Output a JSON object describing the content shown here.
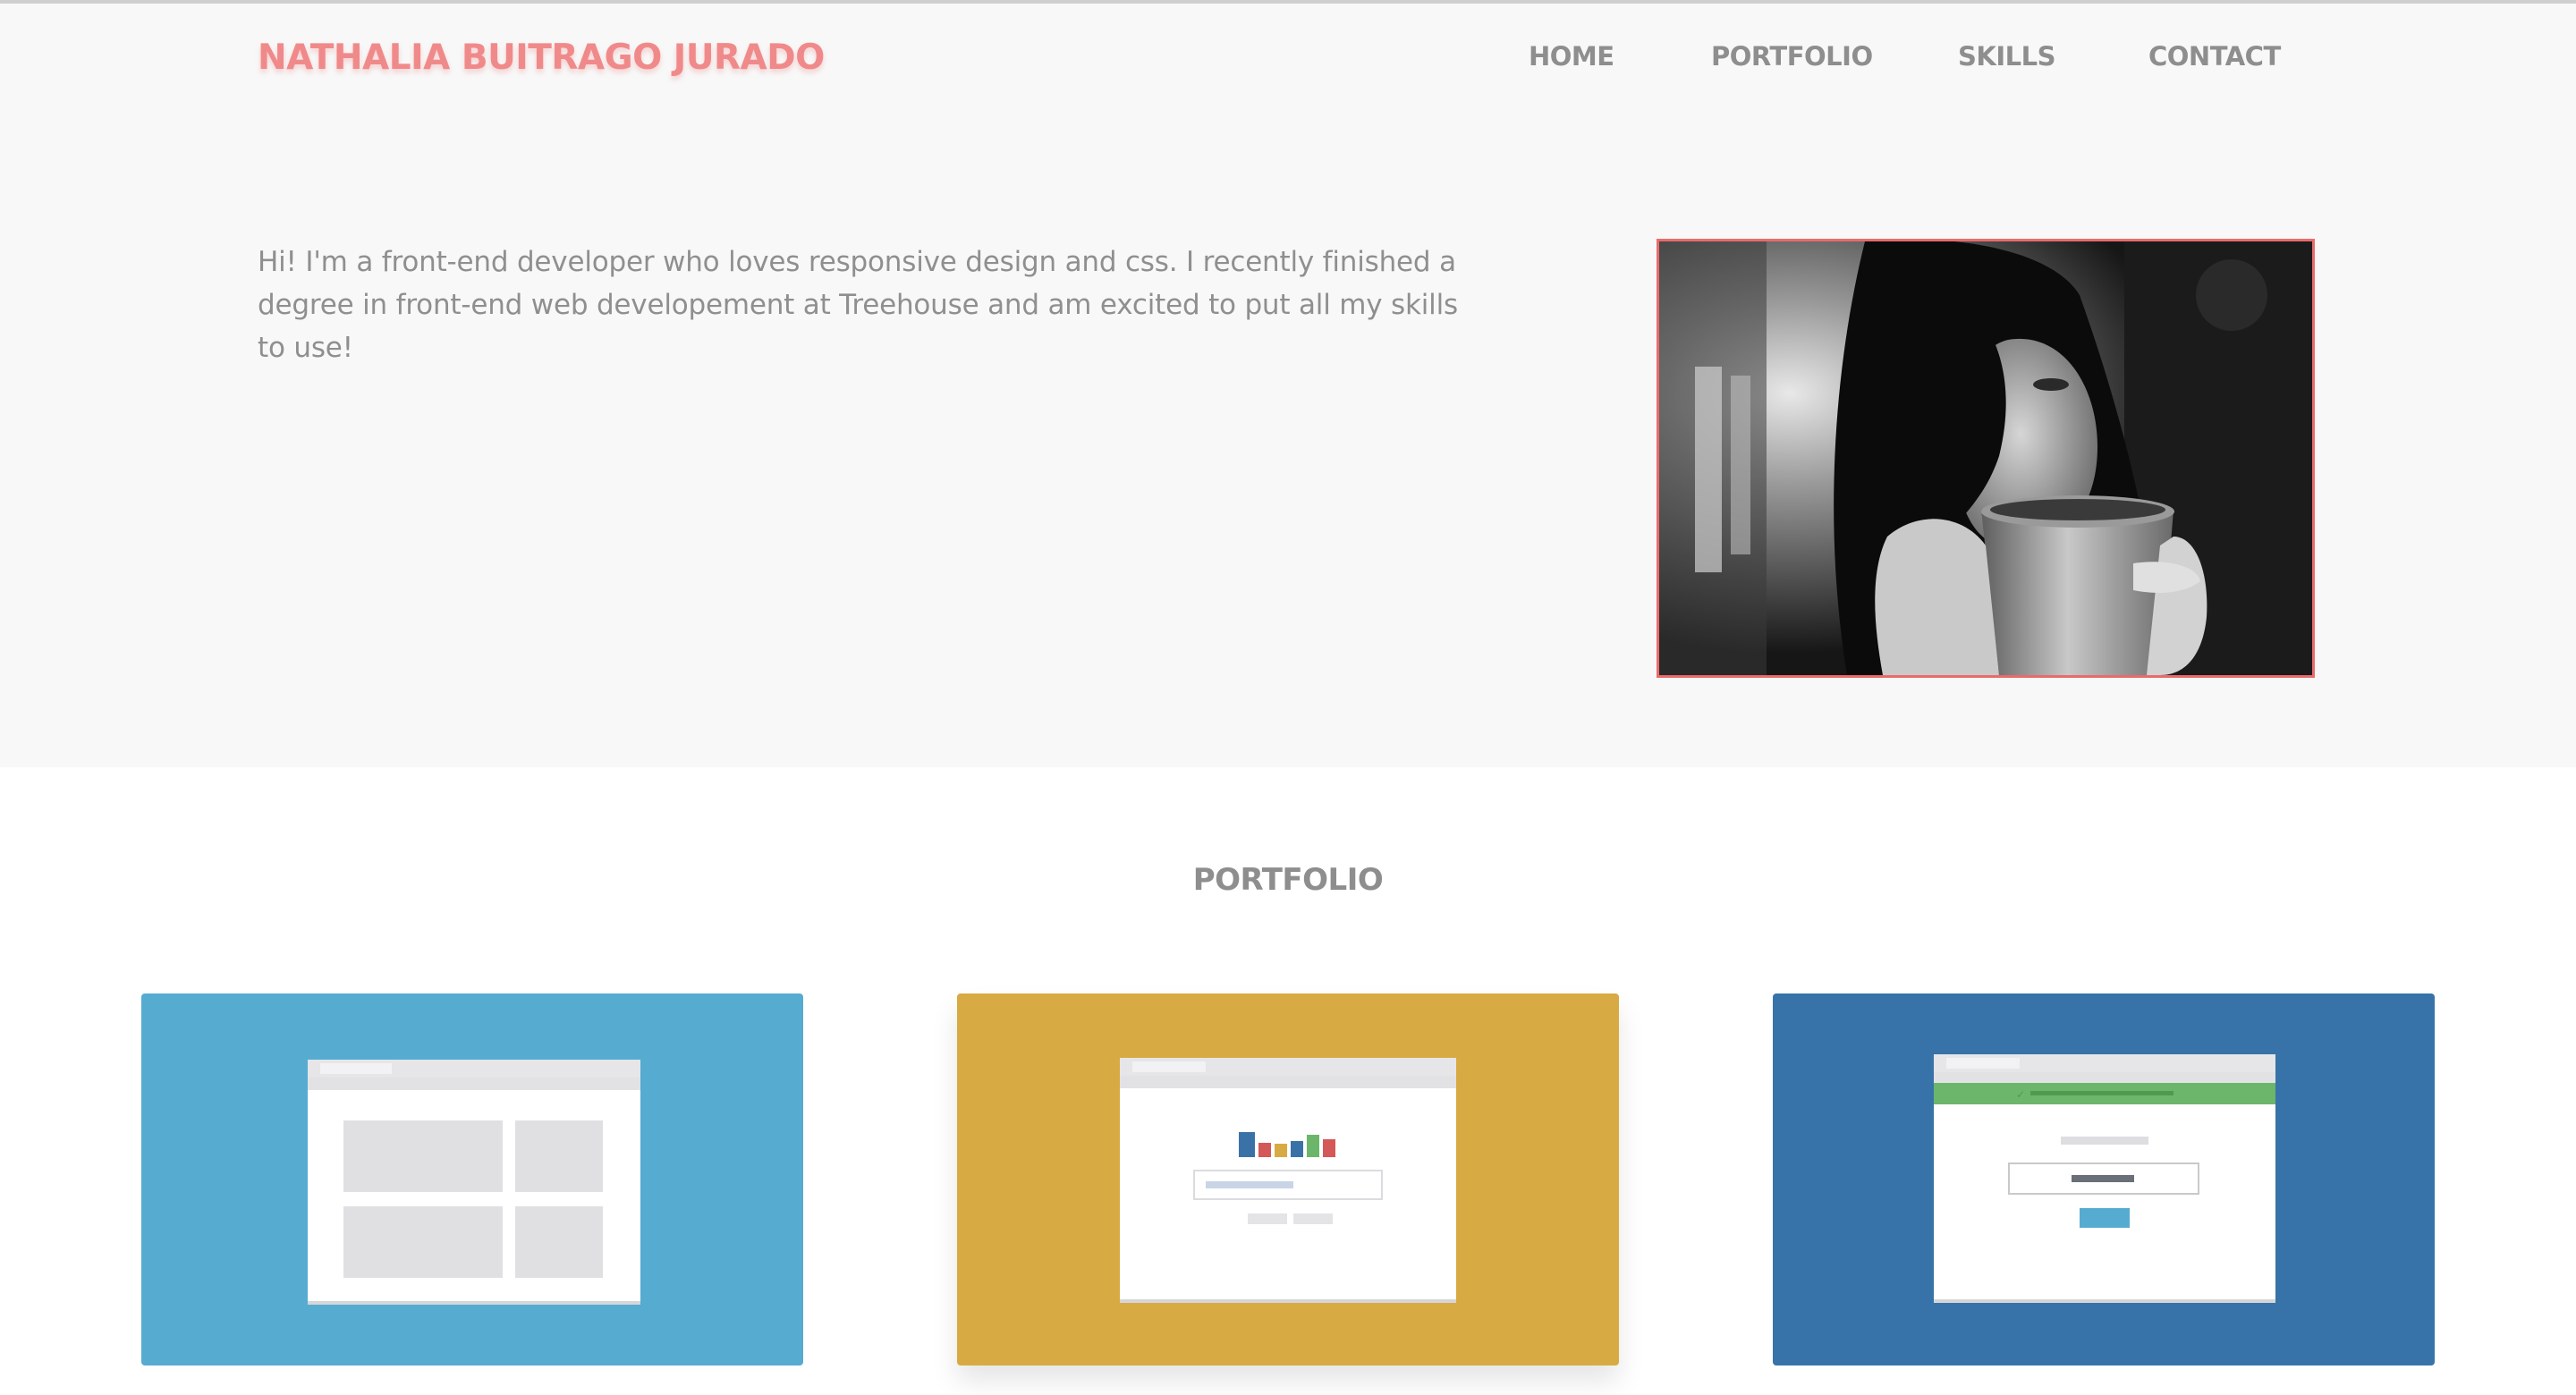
{
  "header": {
    "brand": "NATHALIA BUITRAGO JURADO",
    "nav": {
      "home": "HOME",
      "portfolio": "PORTFOLIO",
      "skills": "SKILLS",
      "contact": "CONTACT"
    }
  },
  "hero": {
    "intro": "Hi! I'm a front-end developer who loves responsive design and css. I recently finished a degree in front-end web developement at Treehouse and am excited to put all my skills to use!",
    "photo_icon": "portrait-photo-coffee"
  },
  "portfolio": {
    "title": "PORTFOLIO",
    "cards": [
      {
        "icon": "layout-grid-wireframe",
        "color": "#56abd0"
      },
      {
        "icon": "bar-chart-wireframe",
        "color": "#d8aa43"
      },
      {
        "icon": "login-form-wireframe",
        "color": "#3773a8"
      }
    ]
  },
  "colors": {
    "brand": "#f08a8a",
    "nav_text": "#8e8e8e",
    "hero_bg": "#f8f8f8",
    "photo_border": "#ea6b6b"
  }
}
